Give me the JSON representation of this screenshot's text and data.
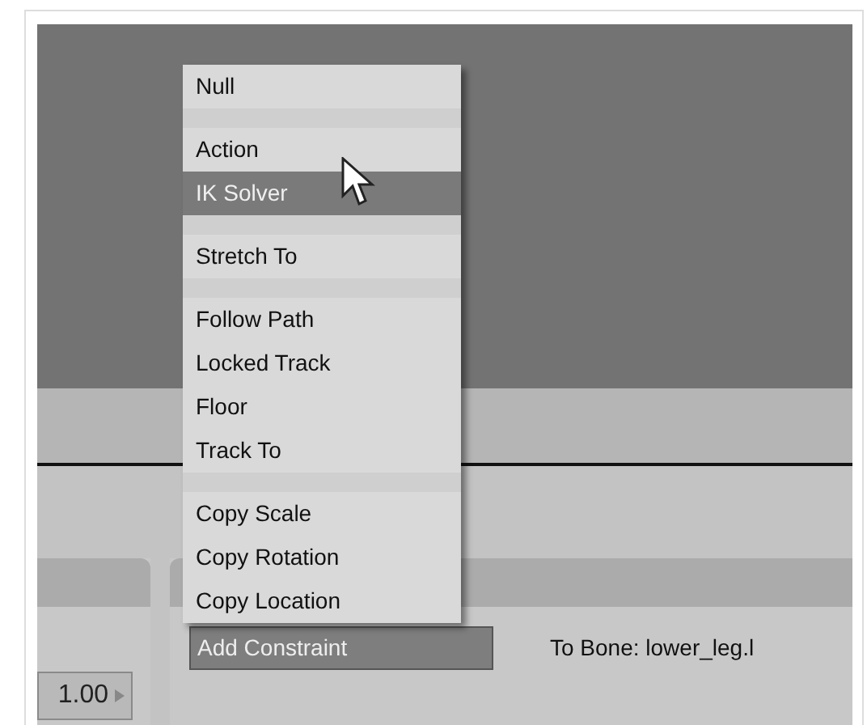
{
  "menu": {
    "items": [
      {
        "kind": "item",
        "label": "Null",
        "selected": false
      },
      {
        "kind": "separator"
      },
      {
        "kind": "item",
        "label": "Action",
        "selected": false
      },
      {
        "kind": "item",
        "label": "IK Solver",
        "selected": true
      },
      {
        "kind": "separator"
      },
      {
        "kind": "item",
        "label": "Stretch To",
        "selected": false
      },
      {
        "kind": "separator"
      },
      {
        "kind": "item",
        "label": "Follow Path",
        "selected": false
      },
      {
        "kind": "item",
        "label": "Locked Track",
        "selected": false
      },
      {
        "kind": "item",
        "label": "Floor",
        "selected": false
      },
      {
        "kind": "item",
        "label": "Track To",
        "selected": false
      },
      {
        "kind": "separator"
      },
      {
        "kind": "item",
        "label": "Copy Scale",
        "selected": false
      },
      {
        "kind": "item",
        "label": "Copy Rotation",
        "selected": false
      },
      {
        "kind": "item",
        "label": "Copy Location",
        "selected": false
      }
    ]
  },
  "constraint_panel": {
    "button": "Add Constraint",
    "target_label": "To Bone: lower_leg.l"
  },
  "left_panel": {
    "number_field": {
      "value": "1.00"
    }
  }
}
